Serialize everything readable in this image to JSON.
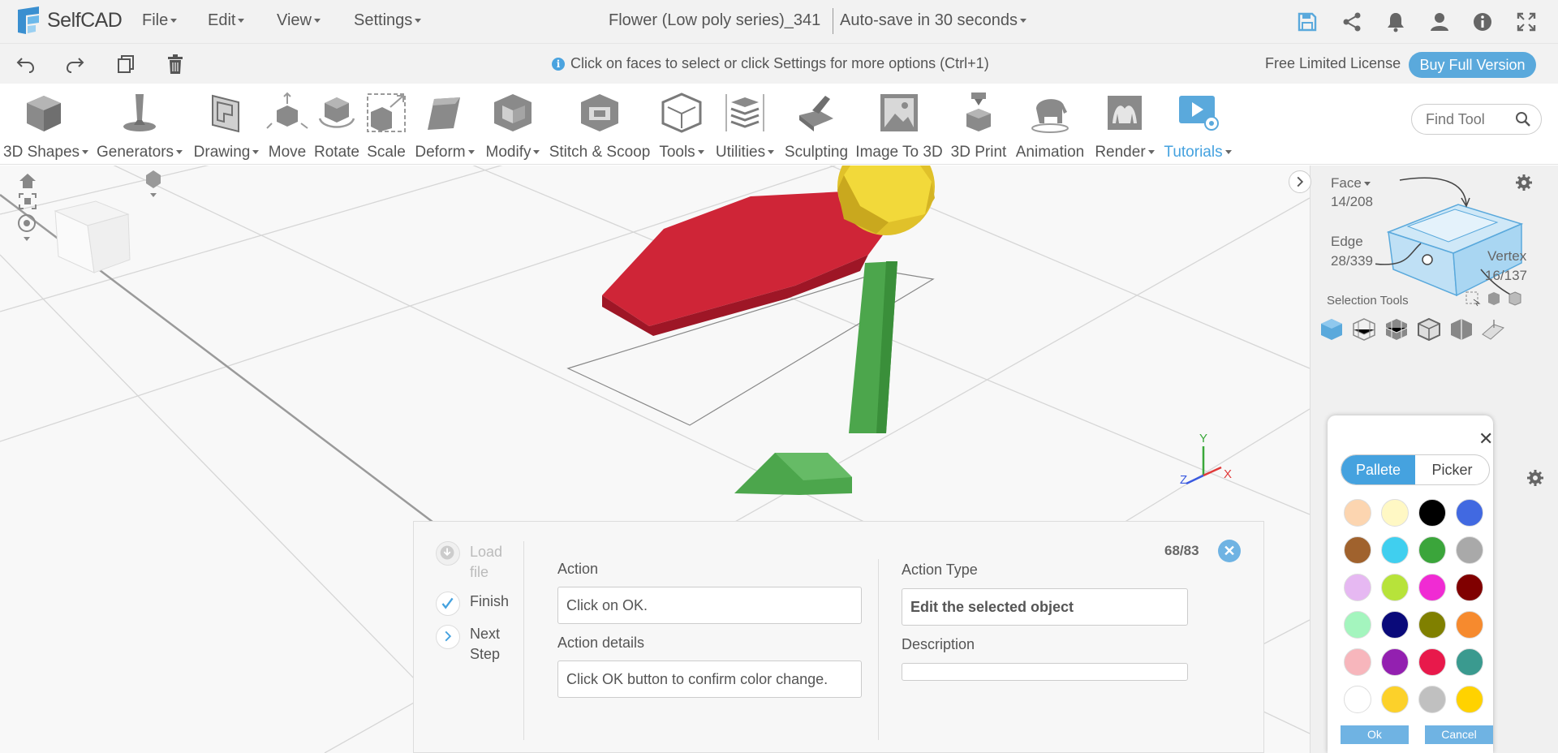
{
  "app": {
    "name": "SelfCAD"
  },
  "menu": [
    "File",
    "Edit",
    "View",
    "Settings"
  ],
  "document": {
    "title": "Flower (Low poly series)_341",
    "autosave": "Auto-save in 30 seconds"
  },
  "top_icons": [
    "save-icon",
    "share-icon",
    "bell-icon",
    "user-icon",
    "info-icon",
    "fullscreen-icon"
  ],
  "hint": "Click on faces to select or click Settings for more options (Ctrl+1)",
  "license": {
    "text": "Free Limited License",
    "button": "Buy Full Version"
  },
  "tools": [
    {
      "label": "3D Shapes",
      "dropdown": true
    },
    {
      "label": "Generators",
      "dropdown": true
    },
    {
      "label": "Drawing",
      "dropdown": true
    },
    {
      "label": "Move",
      "dropdown": false
    },
    {
      "label": "Rotate",
      "dropdown": false
    },
    {
      "label": "Scale",
      "dropdown": false
    },
    {
      "label": "Deform",
      "dropdown": true
    },
    {
      "label": "Modify",
      "dropdown": true
    },
    {
      "label": "Stitch & Scoop",
      "dropdown": false
    },
    {
      "label": "Tools",
      "dropdown": true
    },
    {
      "label": "Utilities",
      "dropdown": true
    },
    {
      "label": "Sculpting",
      "dropdown": false
    },
    {
      "label": "Image To 3D",
      "dropdown": false
    },
    {
      "label": "3D Print",
      "dropdown": false
    },
    {
      "label": "Animation",
      "dropdown": false
    },
    {
      "label": "Render",
      "dropdown": true
    },
    {
      "label": "Tutorials",
      "dropdown": true
    }
  ],
  "find_tool": {
    "placeholder": "Find Tool"
  },
  "selection": {
    "mode": "Face",
    "face_count": "14/208",
    "edge_label": "Edge",
    "edge_count": "28/339",
    "vertex_label": "Vertex",
    "vertex_count": "16/137",
    "tools_label": "Selection Tools"
  },
  "axes": {
    "x": "X",
    "y": "Y",
    "z": "Z"
  },
  "color_picker": {
    "tabs": [
      "Pallete",
      "Picker"
    ],
    "active_tab": "Pallete",
    "swatches": [
      "#fcd5b0",
      "#fff8c4",
      "#000000",
      "#4169e1",
      "#a0622d",
      "#40cfef",
      "#3ba53b",
      "#a9a9a9",
      "#e6b8f2",
      "#b7e33a",
      "#f02bd3",
      "#800000",
      "#a4f5be",
      "#0a0a7a",
      "#808000",
      "#f68a2e",
      "#f7b6bc",
      "#9320b0",
      "#e8194b",
      "#3a9a8f",
      "#ffffff",
      "#fcd12a",
      "#c0c0c0",
      "#ffd200"
    ],
    "ok": "Ok",
    "cancel": "Cancel"
  },
  "step_panel": {
    "nav": [
      {
        "label": "Load file",
        "state": "disabled"
      },
      {
        "label": "Finish",
        "state": "done"
      },
      {
        "label": "Next Step",
        "state": "next"
      }
    ],
    "counter": "68/83",
    "action_label": "Action",
    "action_value": "Click on OK.",
    "details_label": "Action details",
    "details_value": "Click OK button to confirm color change.",
    "type_label": "Action Type",
    "type_value": "Edit the selected object",
    "description_label": "Description",
    "description_value": ""
  },
  "colors": {
    "accent": "#45a2df",
    "petal": "#d3283a",
    "stem": "#4ca64c",
    "center": "#e8c72a"
  }
}
